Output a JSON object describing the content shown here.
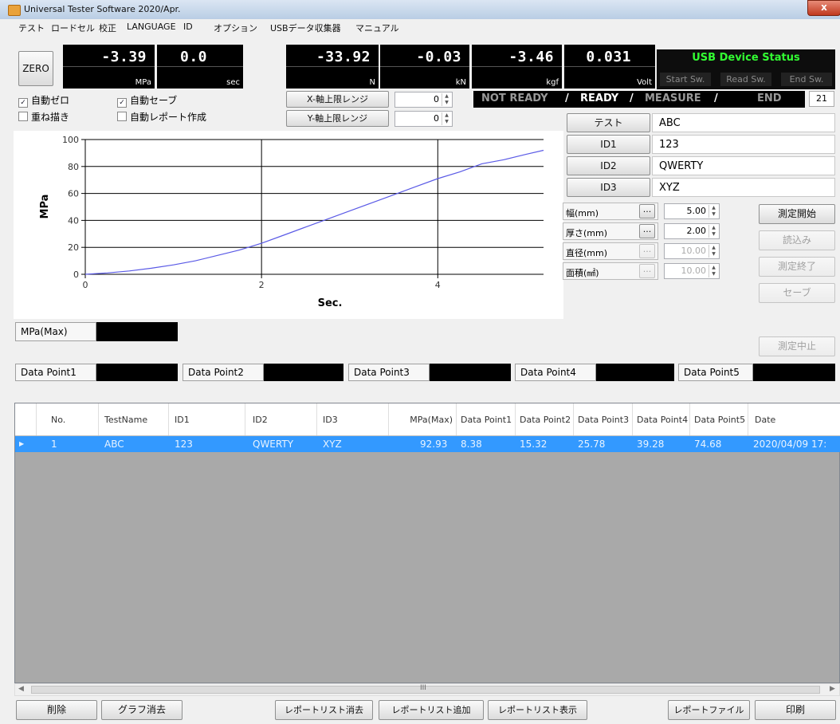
{
  "window": {
    "title": "Universal Tester Software  2020/Apr.",
    "close_label": "x"
  },
  "menu": [
    "テスト",
    "ロードセル",
    "校正",
    "LANGUAGE",
    "ID",
    "オプション",
    "USBデータ収集器",
    "マニュアル"
  ],
  "zero_label": "ZERO",
  "readouts": [
    {
      "value": "-3.39",
      "unit": "MPa"
    },
    {
      "value": "0.0",
      "unit": "sec"
    },
    {
      "value": "-33.92",
      "unit": "N"
    },
    {
      "value": "-0.03",
      "unit": "kN"
    },
    {
      "value": "-3.46",
      "unit": "kgf"
    },
    {
      "value": "0.031",
      "unit": "Volt"
    }
  ],
  "usb": {
    "title": "USB Device Status",
    "start": "Start Sw.",
    "read": "Read Sw.",
    "end": "End Sw."
  },
  "options": {
    "auto_zero": "自動ゼロ",
    "auto_save": "自動セーブ",
    "overlay": "重ね描き",
    "auto_report": "自動レポート作成"
  },
  "range": {
    "x_label": "X-軸上限レンジ",
    "x_value": "0",
    "y_label": "Y-軸上限レンジ",
    "y_value": "0"
  },
  "status": {
    "not_ready": "NOT READY",
    "ready": "READY",
    "measure": "MEASURE",
    "end": "END",
    "slash": "/",
    "count": "21"
  },
  "id_panel": [
    {
      "label": "テスト",
      "value": "ABC"
    },
    {
      "label": "ID1",
      "value": "123"
    },
    {
      "label": "ID2",
      "value": "QWERTY"
    },
    {
      "label": "ID3",
      "value": "XYZ"
    }
  ],
  "dims": [
    {
      "label": "幅(mm)",
      "value": "5.00",
      "enabled": true
    },
    {
      "label": "厚さ(mm)",
      "value": "2.00",
      "enabled": true
    },
    {
      "label": "直径(mm)",
      "value": "10.00",
      "enabled": false
    },
    {
      "label": "面積(㎟)",
      "value": "10.00",
      "enabled": false
    }
  ],
  "dim_button": "...",
  "actions": {
    "start": "測定開始",
    "load": "読込み",
    "finish": "測定終了",
    "save": "セーブ",
    "abort": "測定中止"
  },
  "chart_data": {
    "type": "line",
    "xlabel": "Sec.",
    "ylabel": "MPa",
    "xlim": [
      0,
      5.2
    ],
    "ylim": [
      0,
      100
    ],
    "xticks": [
      "0",
      "2",
      "4"
    ],
    "yticks": [
      "0",
      "20",
      "40",
      "60",
      "80",
      "100"
    ],
    "grid": true,
    "series": [
      {
        "color": "#5a5ae6",
        "x": [
          0,
          0.25,
          0.5,
          0.75,
          1.0,
          1.25,
          1.5,
          1.75,
          2.0,
          2.25,
          2.5,
          2.75,
          3.0,
          3.25,
          3.5,
          3.75,
          4.0,
          4.25,
          4.5,
          4.75,
          5.0,
          5.2
        ],
        "y": [
          0,
          1,
          2.5,
          4.5,
          7,
          10,
          14,
          18,
          23,
          29,
          35,
          41,
          47,
          53,
          59,
          65,
          71,
          76,
          82,
          85,
          89,
          92
        ]
      }
    ]
  },
  "max_label": "MPa(Max)",
  "data_points": [
    "Data Point1",
    "Data Point2",
    "Data Point3",
    "Data Point4",
    "Data Point5"
  ],
  "table": {
    "columns": [
      "No.",
      "TestName",
      "ID1",
      "ID2",
      "ID3",
      "MPa(Max)",
      "Data Point1",
      "Data Point2",
      "Data Point3",
      "Data Point4",
      "Data Point5",
      "Date"
    ],
    "rows": [
      [
        "1",
        "ABC",
        "123",
        "QWERTY",
        "XYZ",
        "92.93",
        "8.38",
        "15.32",
        "25.78",
        "39.28",
        "74.68",
        "2020/04/09 17:"
      ]
    ]
  },
  "scroll_mark": "III",
  "bottom_buttons": [
    "削除",
    "グラフ消去",
    "レポートリスト消去",
    "レポートリスト追加",
    "レポートリスト表示",
    "レポートファイル",
    "印刷"
  ]
}
